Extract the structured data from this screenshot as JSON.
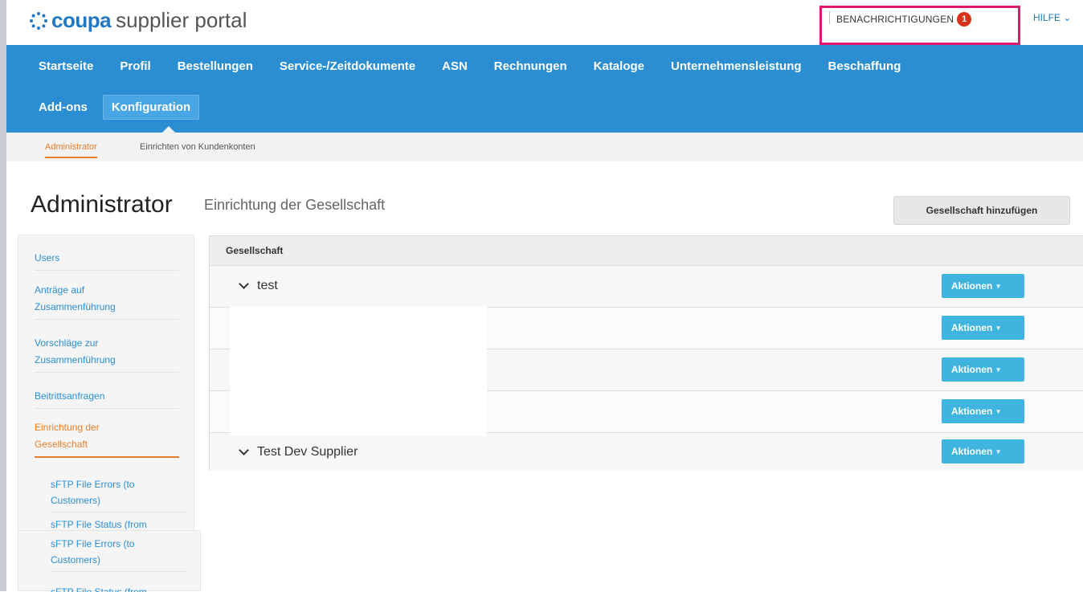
{
  "header": {
    "logo_brand": "coupa",
    "logo_rest": "supplier portal",
    "notifications_label": "BENACHRICHTIGUNGEN",
    "notifications_count": "1",
    "help_label": "HILFE ⌄",
    "accent_color": "#2b8ed3",
    "highlight_color": "#e0186f"
  },
  "nav": {
    "row1": [
      "Startseite",
      "Profil",
      "Bestellungen",
      "Service-/Zeitdokumente",
      "ASN",
      "Rechnungen",
      "Kataloge",
      "Unternehmensleistung",
      "Beschaffung"
    ],
    "row2": [
      "Add-ons",
      "Konfiguration"
    ],
    "active": "Konfiguration"
  },
  "subnav": {
    "items": [
      "Administrator",
      "Einrichten von Kundenkonten"
    ],
    "active": "Administrator"
  },
  "page": {
    "title": "Administrator",
    "subtitle": "Einrichtung der Gesellschaft",
    "add_button": "Gesellschaft hinzufügen"
  },
  "sidebar": {
    "items": [
      {
        "line1": "Users",
        "line2": ""
      },
      {
        "line1": "Anträge auf",
        "line2": "Zusammenführung"
      },
      {
        "line1": "Vorschläge zur",
        "line2": "Zusammenführung"
      },
      {
        "line1": "Beitrittsanfragen",
        "line2": ""
      },
      {
        "line1": "Einrichtung der",
        "line2": "Gesellschaft"
      }
    ],
    "subitems": [
      {
        "line1": "sFTP File Errors (to",
        "line2": "Customers)"
      },
      {
        "line1": "sFTP File Status (from",
        "line2": ""
      }
    ]
  },
  "table": {
    "header": "Gesellschaft",
    "rows": [
      {
        "name": "test",
        "action": "Aktionen"
      },
      {
        "name": "",
        "action": "Aktionen"
      },
      {
        "name": "",
        "action": "Aktionen"
      },
      {
        "name": "",
        "action": "Aktionen"
      },
      {
        "name": "Test Dev Supplier",
        "action": "Aktionen"
      }
    ]
  }
}
